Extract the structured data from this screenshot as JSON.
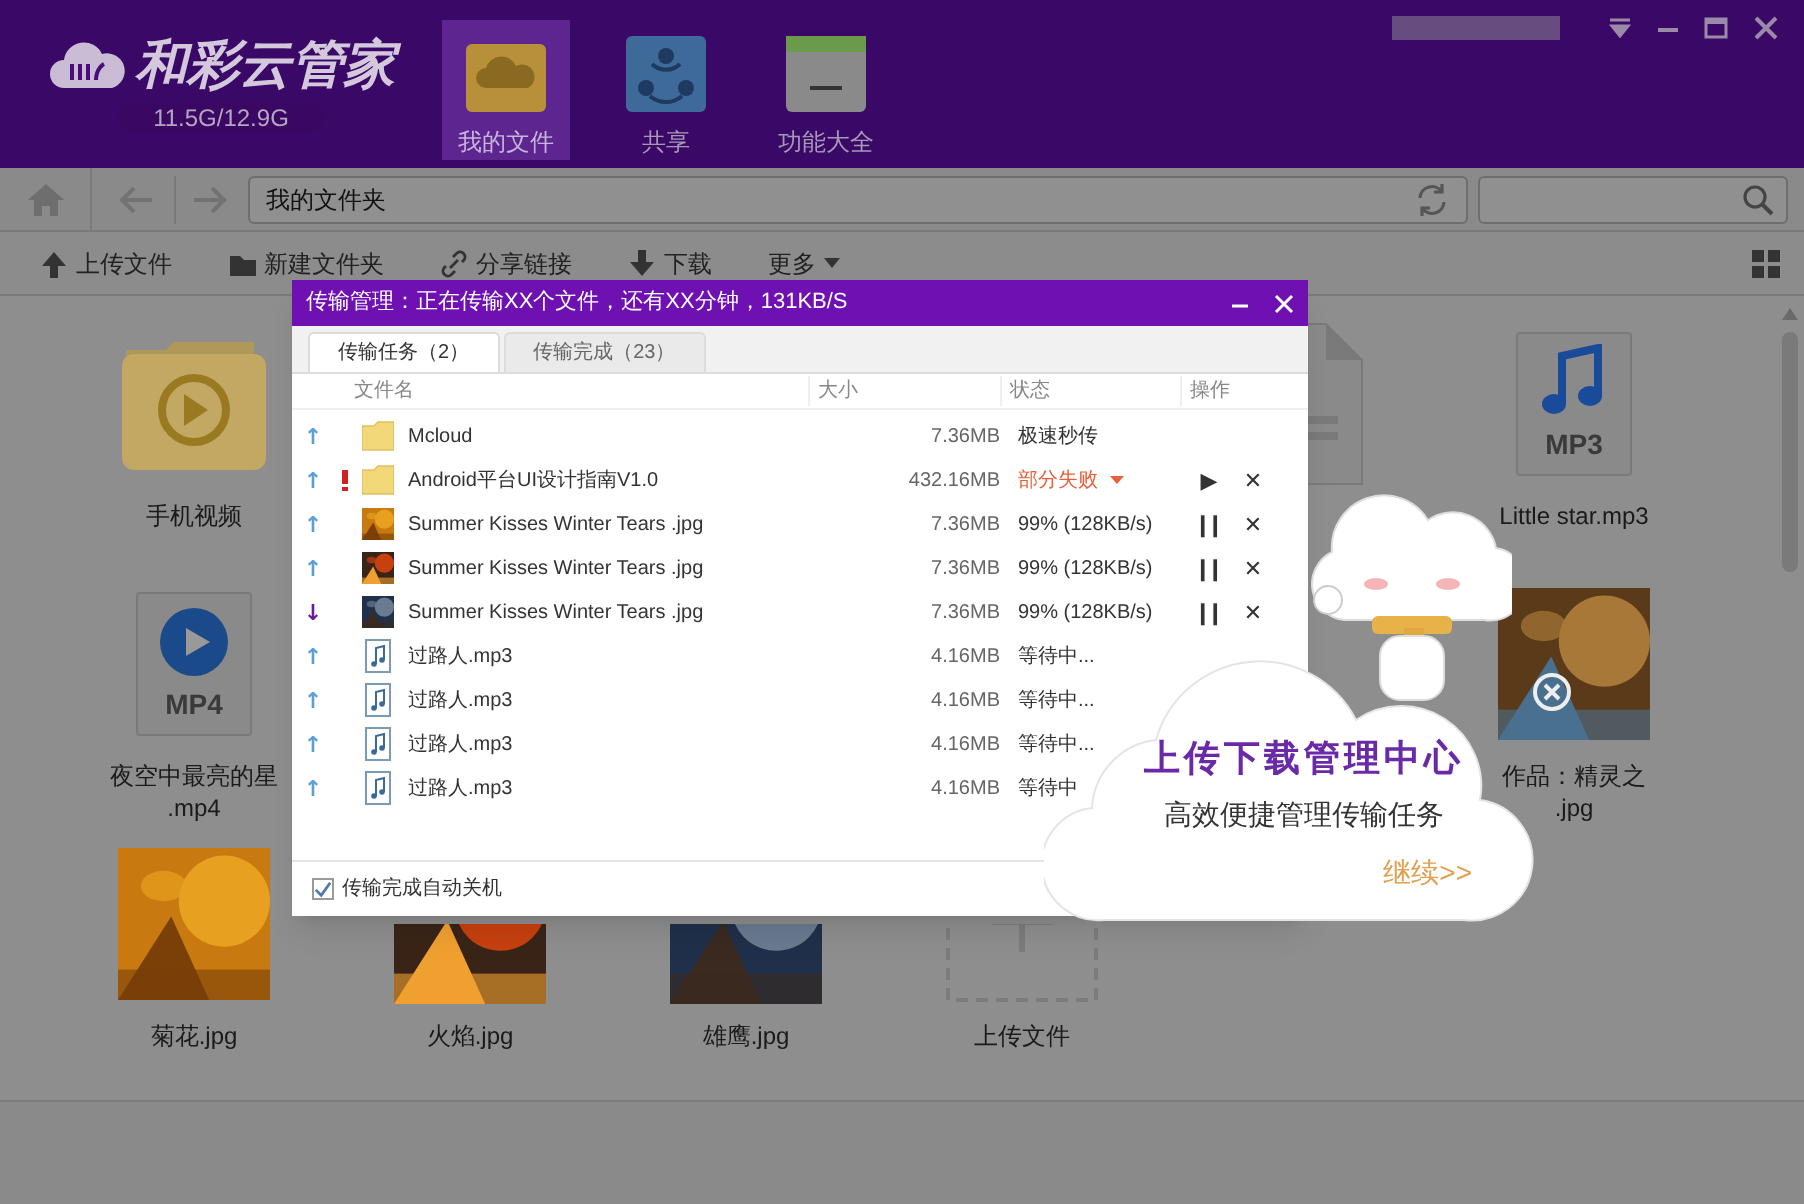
{
  "app": {
    "logo_text": "和彩云管家",
    "storage": "11.5G/12.9G"
  },
  "nav": [
    {
      "label": "我的文件",
      "kind": "files",
      "selected": true
    },
    {
      "label": "共享",
      "kind": "share",
      "selected": false
    },
    {
      "label": "功能大全",
      "kind": "tools",
      "selected": false
    }
  ],
  "address": {
    "path": "我的文件夹"
  },
  "toolbar": [
    {
      "label": "上传文件",
      "kind": "upload"
    },
    {
      "label": "新建文件夹",
      "kind": "new-folder"
    },
    {
      "label": "分享链接",
      "kind": "link"
    },
    {
      "label": "下载",
      "kind": "download"
    },
    {
      "label": "更多",
      "kind": "more"
    }
  ],
  "files": {
    "left_column": [
      {
        "kind": "video-folder",
        "label": "手机视频"
      },
      {
        "kind": "mp4",
        "badge": "MP4",
        "label": "夜空中最亮的星\n.mp4"
      },
      {
        "kind": "picture",
        "label": "菊花.jpg"
      }
    ],
    "bottom_row": [
      {
        "kind": "picture",
        "label": "火焰.jpg"
      },
      {
        "kind": "picture",
        "label": "雄鹰.jpg"
      },
      {
        "kind": "upload-slot",
        "label": "上传文件"
      }
    ],
    "partly_hidden": [
      {
        "kind": "doc"
      }
    ],
    "right_column": [
      {
        "kind": "mp3",
        "badge": "MP3",
        "label": "Little star.mp3"
      },
      {
        "kind": "picture",
        "label": "作品：精灵之\n.jpg"
      }
    ]
  },
  "dialog": {
    "title": "传输管理：正在传输XX个文件，还有XX分钟，131KB/S",
    "tabs": [
      {
        "label": "传输任务（2）",
        "selected": true
      },
      {
        "label": "传输完成（23）",
        "selected": false
      }
    ],
    "columns": [
      "文件名",
      "大小",
      "状态",
      "操作"
    ],
    "rows": [
      {
        "arrow": "↑",
        "color": "#5aa0d0",
        "kind": "folder",
        "failed": false,
        "name": "Mcloud",
        "size": "7.36MB",
        "status": "极速秒传",
        "actions": []
      },
      {
        "arrow": "↑",
        "color": "#5aa0d0",
        "kind": "folder",
        "failed": true,
        "name": "Android平台UI设计指南V1.0",
        "size": "432.16MB",
        "status": "部分失败",
        "actions": [
          "▶",
          "✕"
        ]
      },
      {
        "arrow": "↑",
        "color": "#5aa0d0",
        "failed": false,
        "name": "Summer Kisses Winter Tears .jpg",
        "size": "7.36MB",
        "status": "99% (128KB/s)",
        "actions": [
          "❙❙",
          "✕"
        ]
      },
      {
        "arrow": "↑",
        "color": "#5aa0d0",
        "failed": false,
        "name": "Summer Kisses Winter Tears .jpg",
        "size": "7.36MB",
        "status": "99% (128KB/s)",
        "actions": [
          "❙❙",
          "✕"
        ]
      },
      {
        "arrow": "↓",
        "color": "#6a1a9a",
        "failed": false,
        "name": "Summer Kisses Winter Tears .jpg",
        "size": "7.36MB",
        "status": "99% (128KB/s)",
        "actions": [
          "❙❙",
          "✕"
        ]
      },
      {
        "arrow": "↑",
        "color": "#5aa0d0",
        "kind": "audio",
        "failed": false,
        "name": "过路人.mp3",
        "size": "4.16MB",
        "status": "等待中...",
        "actions": []
      },
      {
        "arrow": "↑",
        "color": "#5aa0d0",
        "kind": "audio",
        "failed": false,
        "name": "过路人.mp3",
        "size": "4.16MB",
        "status": "等待中...",
        "actions": []
      },
      {
        "arrow": "↑",
        "color": "#5aa0d0",
        "kind": "audio",
        "failed": false,
        "name": "过路人.mp3",
        "size": "4.16MB",
        "status": "等待中...",
        "actions": []
      },
      {
        "arrow": "↑",
        "color": "#5aa0d0",
        "kind": "audio",
        "failed": false,
        "name": "过路人.mp3",
        "size": "4.16MB",
        "status": "等待中",
        "actions": []
      }
    ],
    "auto_shutdown": {
      "label": "传输完成自动关机",
      "checked": true
    }
  },
  "promo": {
    "title": "上传下载管理中心",
    "subtitle": "高效便捷管理传输任务",
    "link": "继续>>"
  }
}
